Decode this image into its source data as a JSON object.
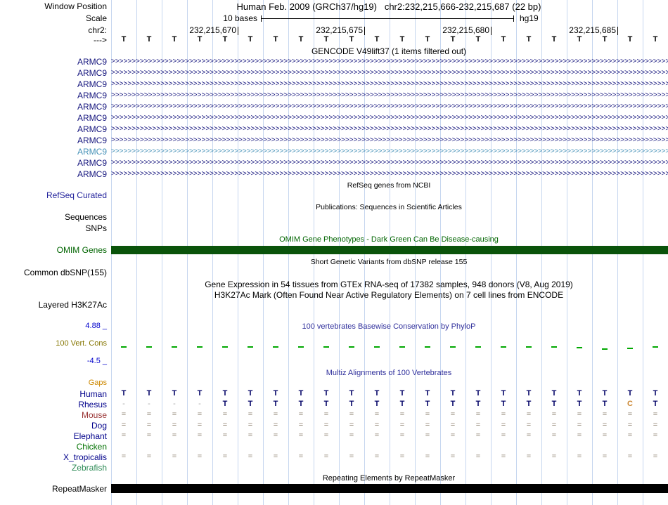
{
  "colors": {
    "gridline": "#c6d6ef",
    "gene_dark": "#14147d",
    "gene_light": "#4792b8",
    "refseq_blue": "#22229c",
    "title_blue": "#30309c",
    "dark_green": "#006400",
    "omim_bar": "#0a530a",
    "olive": "#857500",
    "blue_axis": "#0000cc",
    "orange": "#cc8800",
    "tick_green": "#00a800",
    "repeat_bar": "#000000"
  },
  "header": {
    "window_position_label": "Window Position",
    "position_title": "Human Feb. 2009 (GRCh37/hg19)   chr2:232,215,666-232,215,687 (22 bp)",
    "scale_label": "Scale",
    "scale_text": "10 bases",
    "assembly": "hg19",
    "chrom_label": "chr2:",
    "ruler": [
      "232,215,670",
      "232,215,675",
      "232,215,680",
      "232,215,685"
    ],
    "strand_label": "--->",
    "sequence": "TTTTTTTTTTTTTTTTTTTTTT"
  },
  "gencode": {
    "title": "GENCODE V49lift37 (1 items filtered out)",
    "arrow_char": ">",
    "transcripts": [
      {
        "label": "ARMC9",
        "shade": "dark"
      },
      {
        "label": "ARMC9",
        "shade": "dark"
      },
      {
        "label": "ARMC9",
        "shade": "dark"
      },
      {
        "label": "ARMC9",
        "shade": "dark"
      },
      {
        "label": "ARMC9",
        "shade": "dark"
      },
      {
        "label": "ARMC9",
        "shade": "dark"
      },
      {
        "label": "ARMC9",
        "shade": "dark"
      },
      {
        "label": "ARMC9",
        "shade": "dark"
      },
      {
        "label": "ARMC9",
        "shade": "light"
      },
      {
        "label": "ARMC9",
        "shade": "dark"
      },
      {
        "label": "ARMC9",
        "shade": "dark"
      }
    ]
  },
  "refseq": {
    "title": "RefSeq genes from NCBI",
    "label": "RefSeq Curated"
  },
  "publications": {
    "title": "Publications: Sequences in Scientific Articles",
    "sequences_label": "Sequences",
    "snps_label": "SNPs"
  },
  "omim": {
    "title": "OMIM Gene Phenotypes - Dark Green Can Be Disease-causing",
    "label": "OMIM Genes"
  },
  "dbsnp": {
    "title": "Short Genetic Variants from dbSNP release 155",
    "label": "Common dbSNP(155)"
  },
  "gtex": {
    "title": "Gene Expression in 54 tissues from GTEx RNA-seq of 17382 samples, 948 donors (V8, Aug 2019)"
  },
  "h3k27ac": {
    "title": "H3K27Ac Mark (Often Found Near Active Regulatory Elements) on 7 cell lines from ENCODE",
    "label": "Layered H3K27Ac"
  },
  "phylop": {
    "title": "100 vertebrates Basewise Conservation by PhyloP",
    "label": "100 Vert. Cons",
    "max_label": "4.88 _",
    "min_label": "-4.5 _",
    "tick_offsets": [
      0,
      0,
      0,
      0,
      0,
      0,
      0,
      0,
      0,
      0,
      0,
      0,
      0,
      0,
      0,
      0,
      0,
      0,
      1,
      3,
      2,
      0
    ]
  },
  "multiz": {
    "title": "Multiz Alignments of 100 Vertebrates",
    "gaps_label": "Gaps",
    "char_colors": {
      "T": "#000066",
      "C": "#cc8833",
      "=": "#8b7d6b",
      "-": "#a9a9a9"
    },
    "species": [
      {
        "name": "Human",
        "color": "#00008b",
        "row": "TTTTTTTTTTTTTTTTTTTTTT"
      },
      {
        "name": "Rhesus",
        "color": "#00008b",
        "row": "----TTTTTTTTTTTTTTTTCT"
      },
      {
        "name": "Mouse",
        "color": "#993333",
        "row": "======================"
      },
      {
        "name": "Dog",
        "color": "#00008b",
        "row": "======================"
      },
      {
        "name": "Elephant",
        "color": "#00008b",
        "row": "======================"
      },
      {
        "name": "Chicken",
        "color": "#007000",
        "row": ""
      },
      {
        "name": "X_tropicalis",
        "color": "#00008b",
        "row": "======================"
      },
      {
        "name": "Zebrafish",
        "color": "#2e8b57",
        "row": ""
      }
    ]
  },
  "repeatmasker": {
    "title": "Repeating Elements by RepeatMasker",
    "label": "RepeatMasker"
  }
}
